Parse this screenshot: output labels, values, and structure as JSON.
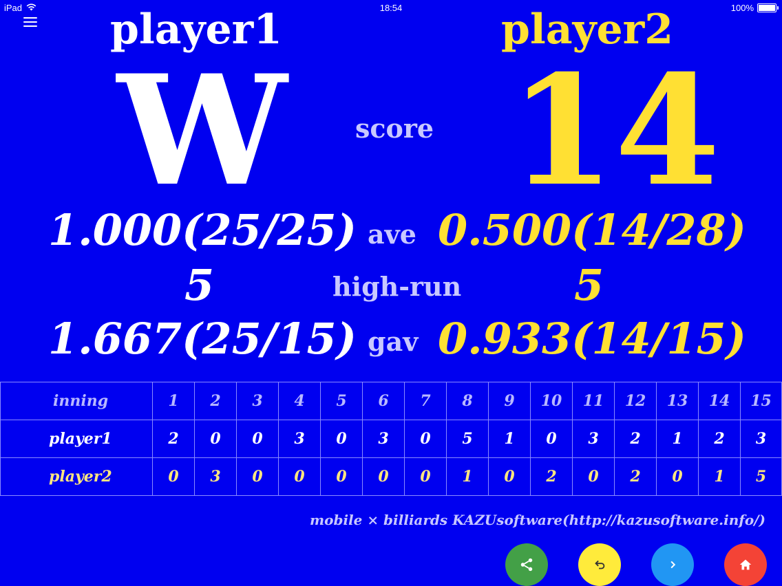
{
  "status_bar": {
    "device": "iPad",
    "time": "18:54",
    "battery": "100%"
  },
  "players": {
    "p1_name": "player1",
    "p2_name": "player2"
  },
  "score": {
    "label": "score",
    "p1": "W",
    "p2": "14"
  },
  "average": {
    "label": "ave",
    "p1": "1.000(25/25)",
    "p2": "0.500(14/28)"
  },
  "high_run": {
    "label": "high-run",
    "p1": "5",
    "p2": "5"
  },
  "gav": {
    "label": "gav",
    "p1": "1.667(25/15)",
    "p2": "0.933(14/15)"
  },
  "innings_table": {
    "header_label": "inning",
    "innings": [
      "1",
      "2",
      "3",
      "4",
      "5",
      "6",
      "7",
      "8",
      "9",
      "10",
      "11",
      "12",
      "13",
      "14",
      "15"
    ],
    "rows": [
      {
        "label": "player1",
        "values": [
          "2",
          "0",
          "0",
          "3",
          "0",
          "3",
          "0",
          "5",
          "1",
          "0",
          "3",
          "2",
          "1",
          "2",
          "3"
        ]
      },
      {
        "label": "player2",
        "values": [
          "0",
          "3",
          "0",
          "0",
          "0",
          "0",
          "0",
          "1",
          "0",
          "2",
          "0",
          "2",
          "0",
          "1",
          "5"
        ]
      }
    ]
  },
  "footer": "mobile × billiards KAZUsoftware(http://kazusoftware.info/)",
  "buttons": {
    "share": {
      "icon": "share-icon",
      "color": "#43a047"
    },
    "undo": {
      "icon": "undo-icon",
      "color": "#ffeb3b"
    },
    "next": {
      "icon": "chevron-right-icon",
      "color": "#2196f3"
    },
    "home": {
      "icon": "home-icon",
      "color": "#f44336"
    }
  },
  "colors": {
    "background": "#0000f0",
    "player1": "#ffffff",
    "player2": "#ffe033",
    "label": "#c8c8ff"
  }
}
